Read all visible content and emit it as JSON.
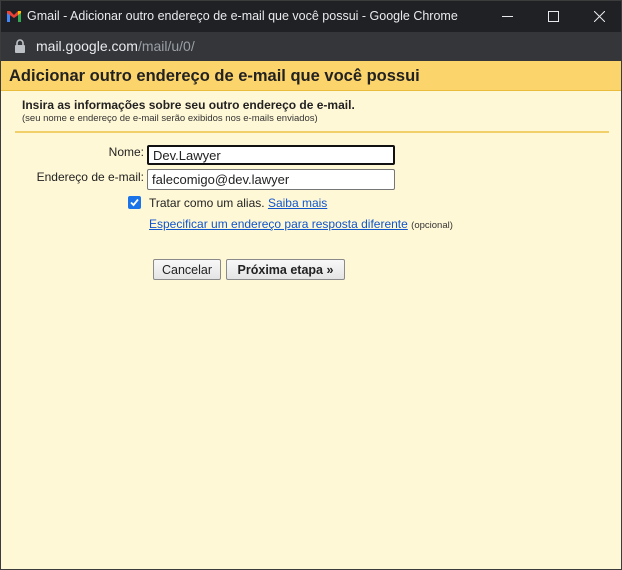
{
  "window": {
    "title": "Gmail - Adicionar outro endereço de e-mail que você possui - Google Chrome",
    "controls": [
      "minimize-icon",
      "maximize-icon",
      "close-icon"
    ]
  },
  "addressbar": {
    "host": "mail.google.com",
    "path": "/mail/u/0/"
  },
  "dialog": {
    "title": "Adicionar outro endereço de e-mail que você possui",
    "subtitle": "Insira as informações sobre seu outro endereço de e-mail.",
    "note": "(seu nome e endereço de e-mail serão exibidos nos e-mails enviados)",
    "name_label": "Nome:",
    "name_value": "Dev.Lawyer",
    "email_label": "Endereço de e-mail:",
    "email_value": "falecomigo@dev.lawyer",
    "alias_checked": true,
    "alias_label": "Tratar como um alias.",
    "learn_more": "Saiba mais",
    "reply_link": "Especificar um endereço para resposta diferente",
    "optional": "(opcional)",
    "cancel_label": "Cancelar",
    "next_label": "Próxima etapa »"
  },
  "colors": {
    "header_bg": "#fcd46c",
    "body_bg": "#fff8d6",
    "titlebar_bg": "#202124",
    "link": "#1155cc",
    "checkbox": "#1a73e8"
  }
}
